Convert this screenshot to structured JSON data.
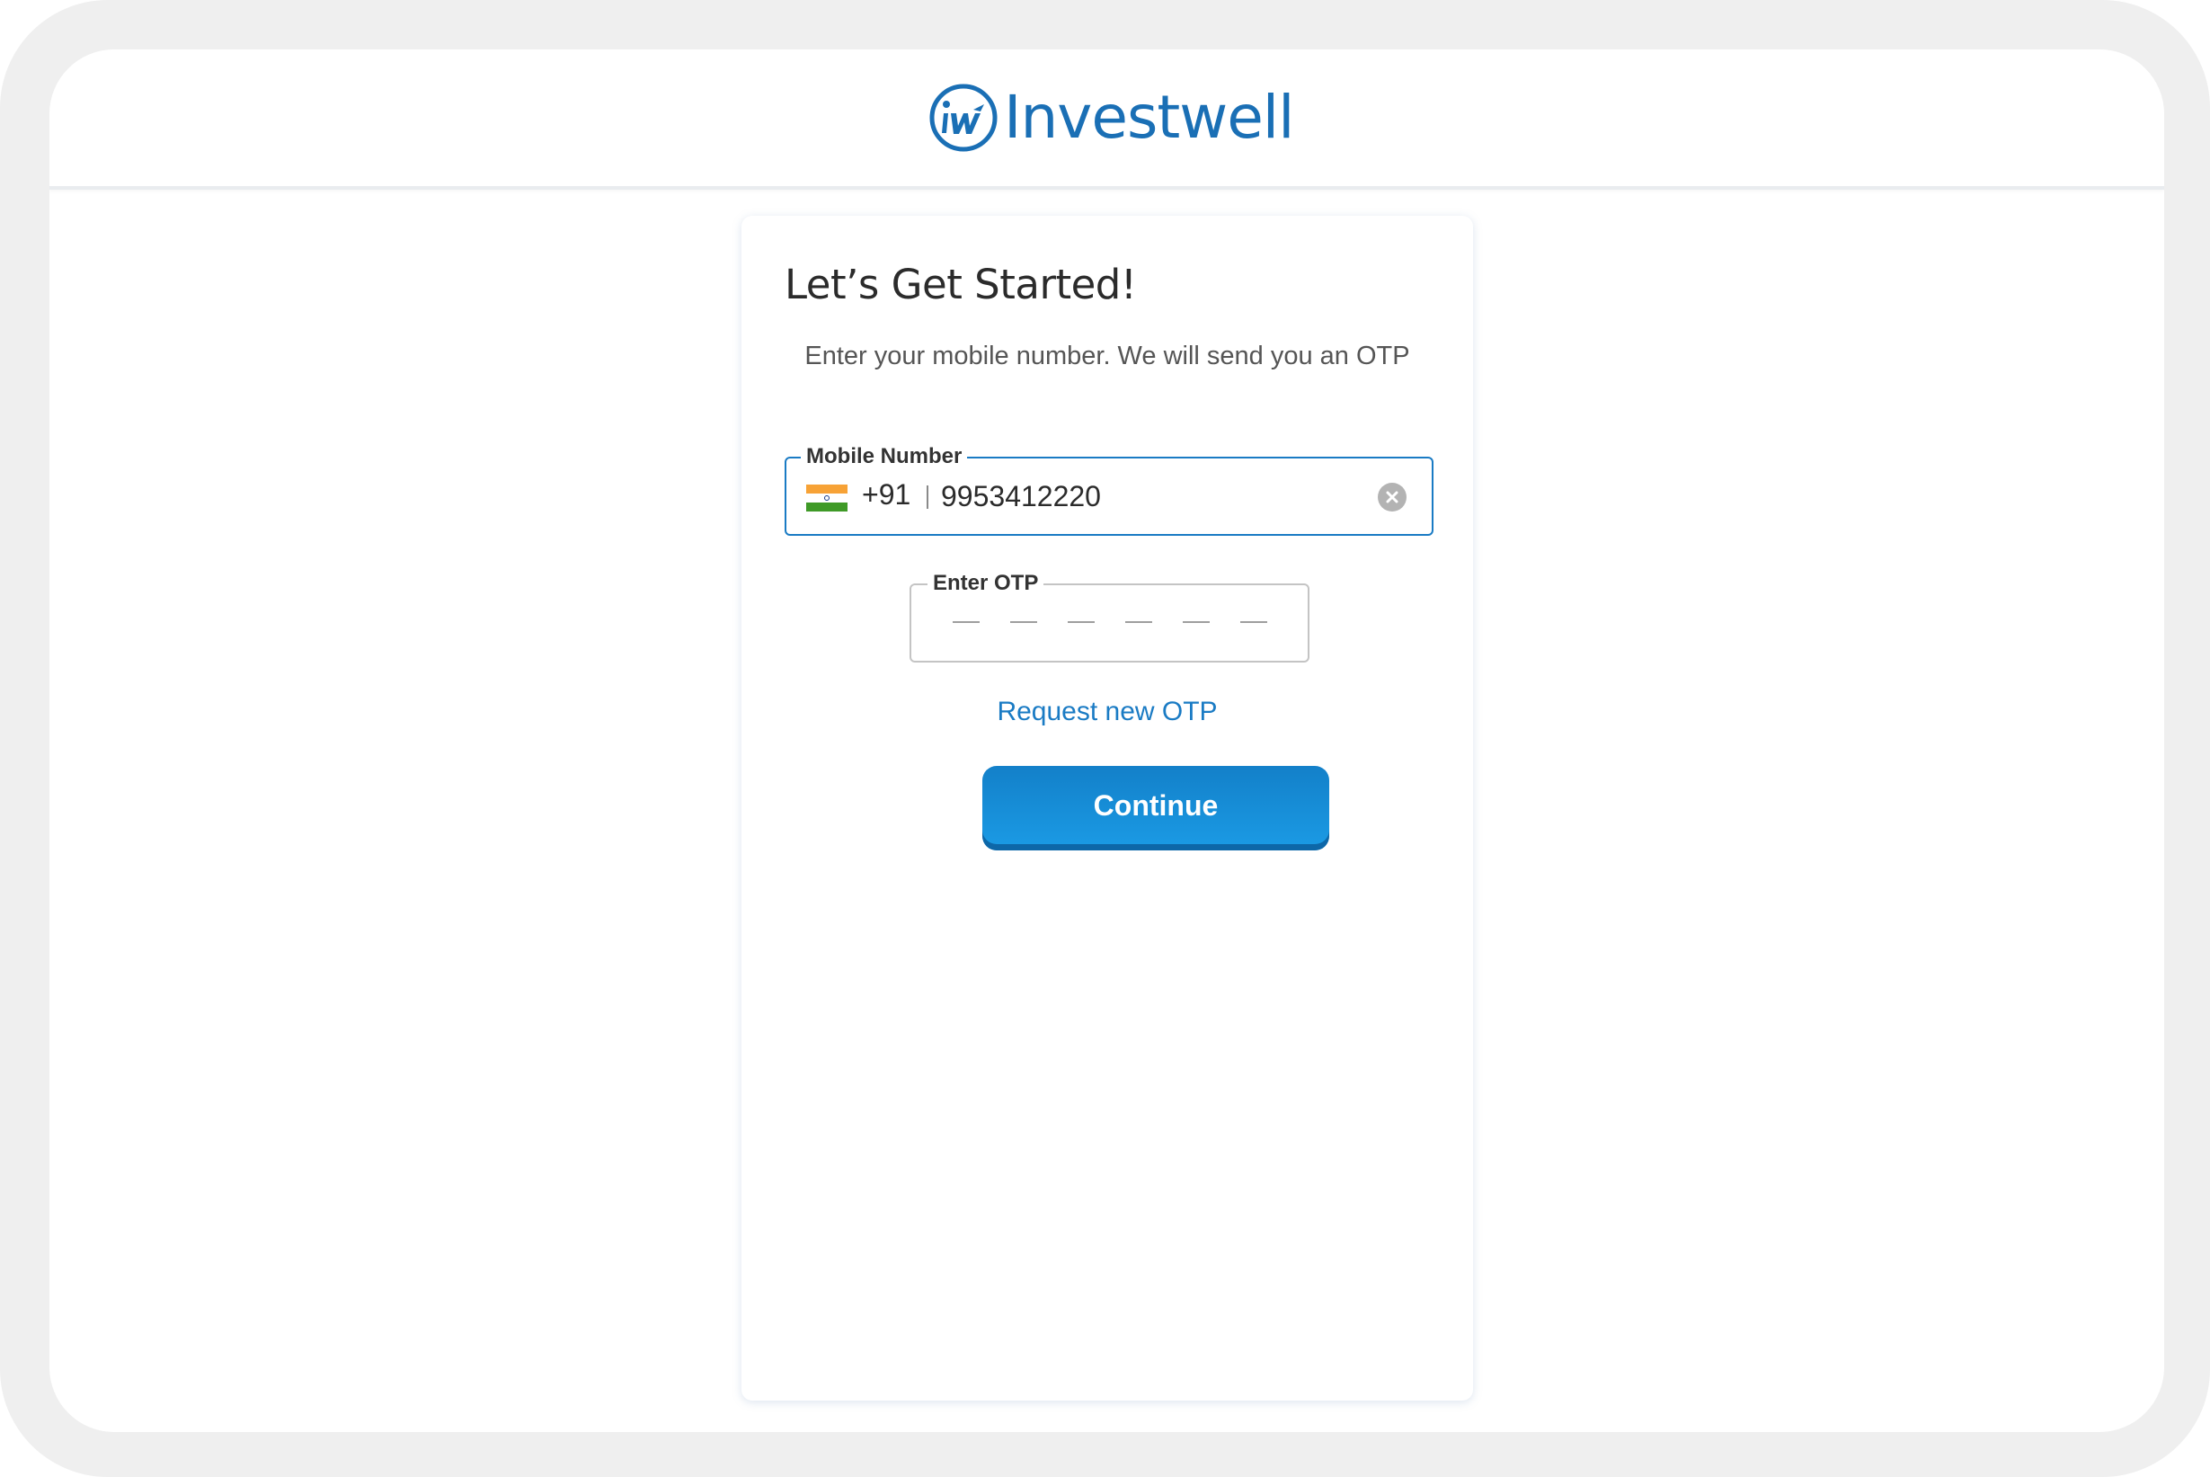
{
  "brand": {
    "name": "Investwell",
    "logo_icon": "investwell-logo-icon",
    "color": "#1a6fb5"
  },
  "card": {
    "title": "Let’s Get Started!",
    "subtitle": "Enter your mobile number. We will send you an OTP"
  },
  "mobile_field": {
    "label": "Mobile Number",
    "country_flag": "india-flag-icon",
    "country_code": "+91",
    "value": "9953412220",
    "clear_icon": "clear-circle-icon",
    "border_color": "#1a7bc4"
  },
  "otp_field": {
    "label": "Enter OTP",
    "slots": [
      "",
      "",
      "",
      "",
      "",
      ""
    ]
  },
  "actions": {
    "resend_label": "Request new OTP",
    "continue_label": "Continue",
    "button_color": "#1b8ad6"
  }
}
